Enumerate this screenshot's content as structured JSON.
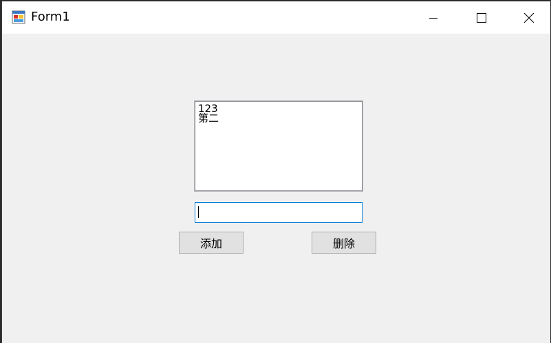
{
  "window": {
    "title": "Form1",
    "icon": "winforms-app-icon",
    "controls": {
      "minimize": "minimize-icon",
      "maximize": "maximize-icon",
      "close": "close-icon"
    }
  },
  "form": {
    "listbox": {
      "items": [
        "123",
        "第二"
      ]
    },
    "textbox": {
      "value": ""
    },
    "buttons": {
      "add_label": "添加",
      "delete_label": "删除"
    }
  },
  "colors": {
    "form_background": "#f0f0f0",
    "titlebar_background": "#ffffff",
    "focus_border": "#0078d7",
    "button_background": "#e1e1e1"
  }
}
